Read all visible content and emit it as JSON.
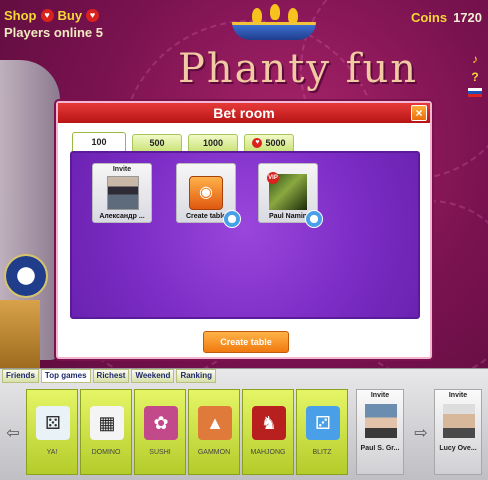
{
  "header": {
    "shop_label": "Shop",
    "buy_label": "Buy",
    "players_online": "Players online 5",
    "coins_label": "Coins",
    "coins_value": "1720",
    "logo_text": "Phanty fun"
  },
  "side_icons": [
    "♪",
    "?"
  ],
  "modal": {
    "title": "Bet room",
    "close_label": "×",
    "tabs": [
      {
        "label": "100"
      },
      {
        "label": "500"
      },
      {
        "label": "1000"
      },
      {
        "label": "5000"
      }
    ],
    "cards": [
      {
        "top": "Invite",
        "bottom": "Александр ..."
      },
      {
        "top": "",
        "bottom": "Create table"
      },
      {
        "top": "",
        "bottom": "Paul Namin"
      }
    ],
    "create_table_button": "Create table"
  },
  "bottom_bar": {
    "tabs": [
      "Friends",
      "Top games",
      "Richest",
      "Weekend",
      "Ranking"
    ],
    "games": [
      {
        "label": "YA!",
        "color": "#e8f2f7"
      },
      {
        "label": "DOMINO",
        "color": "#f4f4f4"
      },
      {
        "label": "SUSHI",
        "color": "#c24a8b"
      },
      {
        "label": "GAMMON",
        "color": "#e07a3a"
      },
      {
        "label": "MAHJONG",
        "color": "#b81f1f"
      },
      {
        "label": "BLITZ",
        "color": "#4aa0e8"
      }
    ],
    "friends": [
      {
        "invite": "Invite",
        "name": "Paul S. Gr..."
      },
      {
        "invite": "Invite",
        "name": "Lucy Ove..."
      }
    ]
  }
}
